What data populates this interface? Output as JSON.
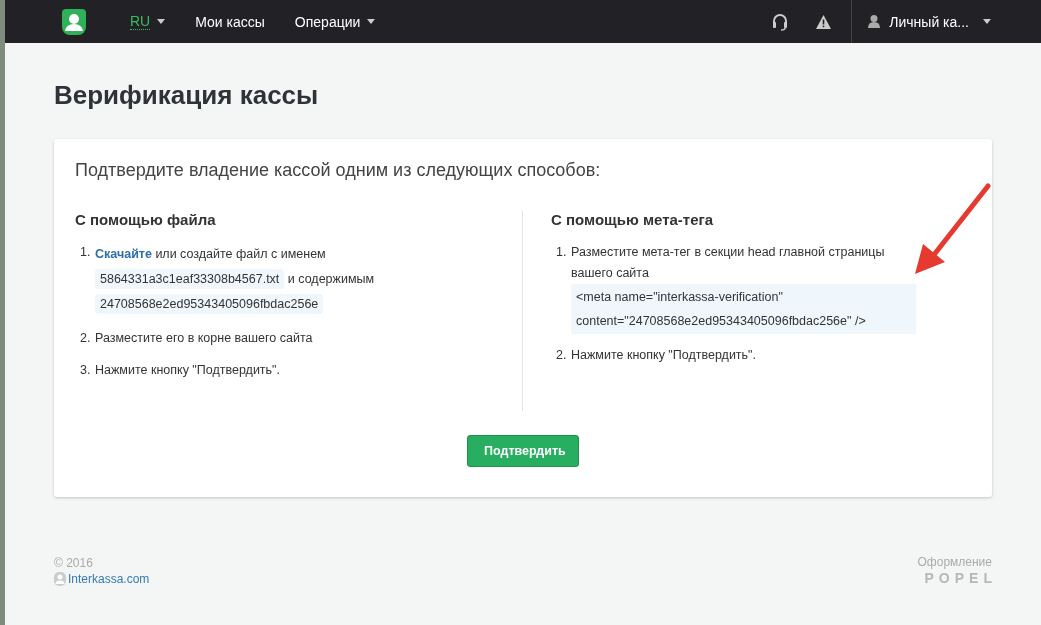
{
  "navbar": {
    "language": "RU",
    "links": [
      {
        "label": "Мои кассы",
        "dropdown": false
      },
      {
        "label": "Операции",
        "dropdown": true
      }
    ],
    "account": "Личный ка..."
  },
  "page_title": "Верификация кассы",
  "card": {
    "intro": "Подтвердите владение кассой одним из следующих способов:",
    "file_method": {
      "heading": "С помощью файла",
      "steps": [
        {
          "kind": "download",
          "number": "1.",
          "link": "Скачайте",
          "text": "или создайте файл с именем",
          "filename": "5864331a3c1eaf33308b4567.txt",
          "text2": "и содержимым",
          "content": "24708568e2ed95343405096fbdac256e"
        },
        {
          "kind": "text",
          "number": "2.",
          "text": "Разместите его в корне вашего сайта"
        },
        {
          "kind": "text",
          "number": "3.",
          "text": "Нажмите кнопку \"Подтвердить\"."
        }
      ]
    },
    "meta_method": {
      "heading": "С помощью мета-тега",
      "steps": [
        {
          "kind": "code",
          "number": "1.",
          "text": "Разместите мета-тег в секции head главной страницы вашего сайта",
          "code_lines": [
            "<meta name=\"interkassa-verification\"",
            "content=\"24708568e2ed95343405096fbdac256e\" />"
          ]
        },
        {
          "kind": "text",
          "number": "2.",
          "text": "Нажмите кнопку \"Подтвердить\"."
        }
      ]
    },
    "button": "Подтвердить"
  },
  "footer": {
    "copyright": "© 2016",
    "site_link": "Interkassa.com",
    "design_label": "Оформление",
    "designer": "POPEL"
  }
}
